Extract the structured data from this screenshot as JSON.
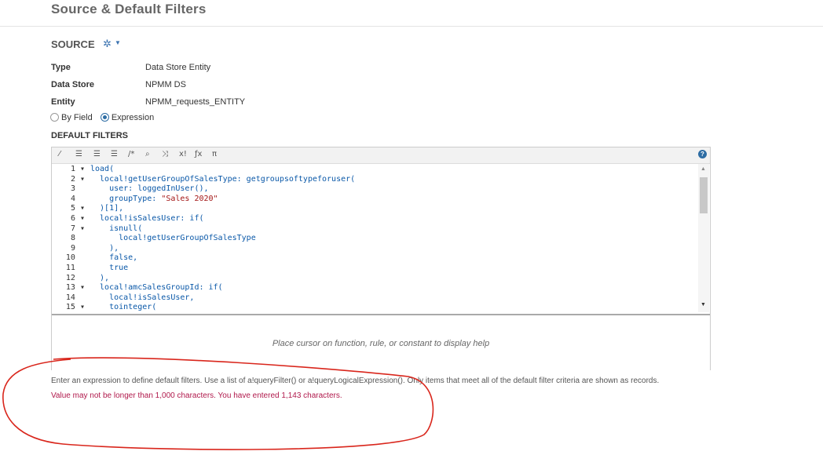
{
  "page": {
    "title": "Source & Default Filters"
  },
  "source": {
    "label": "SOURCE",
    "fields": [
      {
        "key": "Type",
        "value": "Data Store Entity"
      },
      {
        "key": "Data Store",
        "value": "NPMM DS"
      },
      {
        "key": "Entity",
        "value": "NPMM_requests_ENTITY"
      }
    ]
  },
  "mode": {
    "by_field": "By Field",
    "expression": "Expression",
    "selected": "Expression"
  },
  "default_filters": {
    "label": "DEFAULT FILTERS",
    "help_placeholder": "Place cursor on function, rule, or constant to display help",
    "instructions": "Enter an expression to define default filters. Use a list of a!queryFilter() or a!queryLogicalExpression(). Only items that meet all of the default filter criteria are shown as records.",
    "error": "Value may not be longer than 1,000 characters. You have entered 1,143 characters."
  },
  "toolbar": {
    "buttons": [
      "magic-wand-icon",
      "indent-left-icon",
      "indent-right-icon",
      "format-icon",
      "comment-icon",
      "search-icon",
      "shuffle-icon",
      "x-bang-icon",
      "fx-icon",
      "pi-icon"
    ],
    "glyphs": [
      "⁄",
      "☰",
      "☰",
      "☰",
      "/*",
      "⌕",
      "⤨",
      "x!",
      "ƒx",
      "π"
    ],
    "help": "?"
  },
  "code": {
    "lines": [
      {
        "n": "1",
        "fold": "▾",
        "text": "load("
      },
      {
        "n": "2",
        "fold": "▾",
        "text": "  local!getUserGroupOfSalesType: getgroupsoftypeforuser("
      },
      {
        "n": "3",
        "fold": "",
        "text": "    user: loggedInUser(),"
      },
      {
        "n": "4",
        "fold": "",
        "text": "    groupType: ",
        "str": "\"Sales 2020\""
      },
      {
        "n": "5",
        "fold": "▾",
        "text": "  )[1],"
      },
      {
        "n": "6",
        "fold": "▾",
        "text": "  local!isSalesUser: if("
      },
      {
        "n": "7",
        "fold": "▾",
        "text": "    isnull("
      },
      {
        "n": "8",
        "fold": "",
        "text": "      local!getUserGroupOfSalesType"
      },
      {
        "n": "9",
        "fold": "",
        "text": "    ),"
      },
      {
        "n": "10",
        "fold": "",
        "text": "    false,"
      },
      {
        "n": "11",
        "fold": "",
        "text": "    true"
      },
      {
        "n": "12",
        "fold": "",
        "text": "  ),"
      },
      {
        "n": "13",
        "fold": "▾",
        "text": "  local!amcSalesGroupId: if("
      },
      {
        "n": "14",
        "fold": "",
        "text": "    local!isSalesUser,"
      },
      {
        "n": "15",
        "fold": "▾",
        "text": "    tointeger("
      }
    ]
  },
  "colors": {
    "error": "#b0184b",
    "accent": "#2e6da4",
    "annotation": "#d9261c"
  }
}
